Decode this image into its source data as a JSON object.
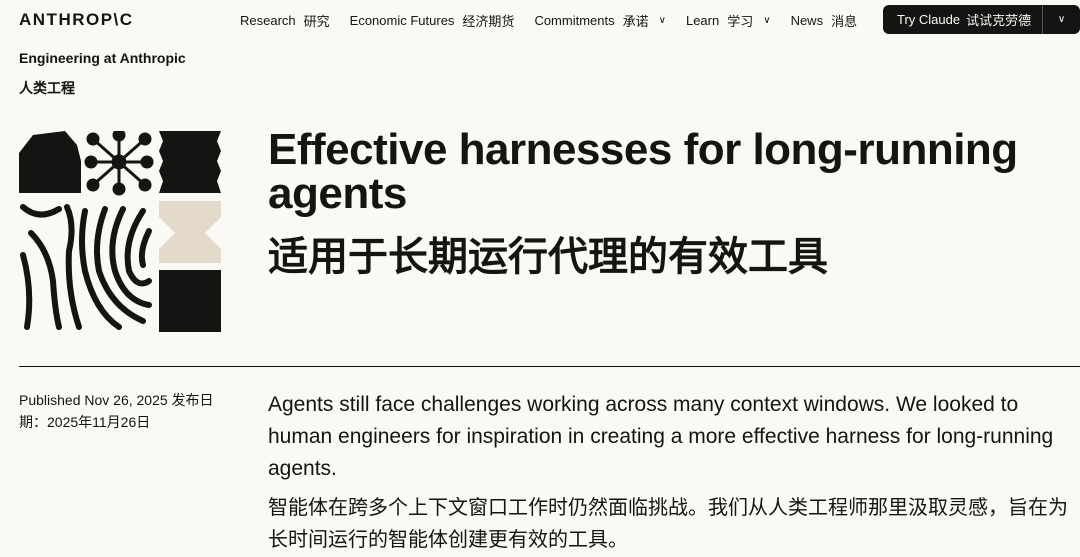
{
  "brand": {
    "logo": "ANTHROP\\C"
  },
  "nav": {
    "items": [
      {
        "label": "Research",
        "zh": "研究",
        "dropdown": false
      },
      {
        "label": "Economic Futures",
        "zh": "经济期货",
        "dropdown": false
      },
      {
        "label": "Commitments",
        "zh": "承诺",
        "dropdown": true
      },
      {
        "label": "Learn",
        "zh": "学习",
        "dropdown": true
      },
      {
        "label": "News",
        "zh": "消息",
        "dropdown": false
      }
    ],
    "cta": {
      "label": "Try Claude",
      "zh": "试试克劳德"
    }
  },
  "section": {
    "label": "Engineering at Anthropic",
    "zh": "人类工程"
  },
  "article": {
    "title": "Effective harnesses for long-running agents",
    "title_zh": "适用于长期运行代理的有效工具",
    "published": "Published Nov 26, 2025 发布日期：2025年11月26日",
    "summary": "Agents still face challenges working across many context windows. We looked to human engineers for inspiration in creating a more effective harness for long-running agents.",
    "summary_zh": "智能体在跨多个上下文窗口工作时仍然面临挑战。我们从人类工程师那里汲取灵感，旨在为长时间运行的智能体创建更有效的工具。"
  },
  "colors": {
    "background": "#faf9f5",
    "ink": "#141413",
    "accent_beige": "#e3dacc"
  }
}
